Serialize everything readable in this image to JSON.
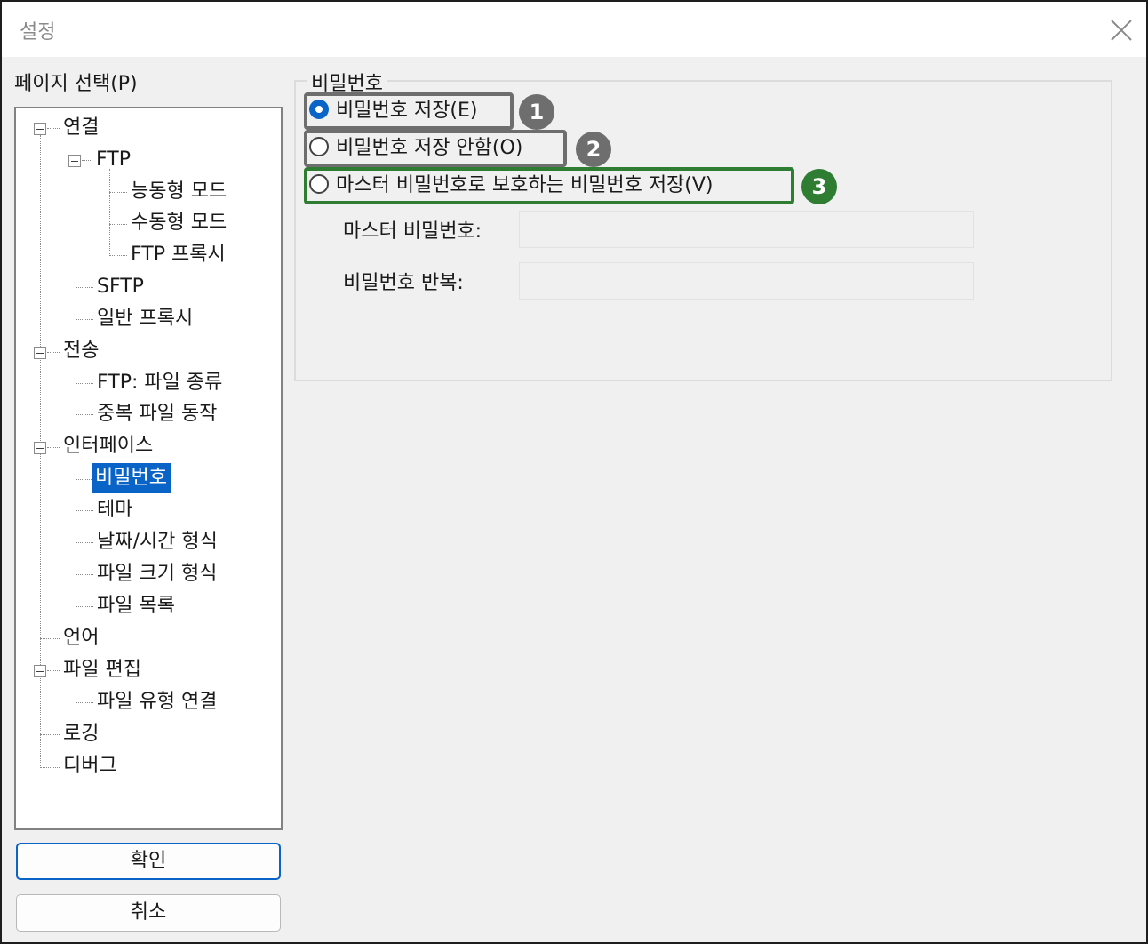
{
  "window": {
    "title": "설정"
  },
  "sidebar": {
    "label": "페이지 선택(P)",
    "tree": [
      {
        "label": "연결"
      },
      {
        "label": "FTP"
      },
      {
        "label": "능동형 모드"
      },
      {
        "label": "수동형 모드"
      },
      {
        "label": "FTP 프록시"
      },
      {
        "label": "SFTP"
      },
      {
        "label": "일반 프록시"
      },
      {
        "label": "전송"
      },
      {
        "label": "FTP: 파일 종류"
      },
      {
        "label": "중복 파일 동작"
      },
      {
        "label": "인터페이스"
      },
      {
        "label": "비밀번호",
        "selected": true
      },
      {
        "label": "테마"
      },
      {
        "label": "날짜/시간 형식"
      },
      {
        "label": "파일 크기 형식"
      },
      {
        "label": "파일 목록"
      },
      {
        "label": "언어"
      },
      {
        "label": "파일 편집"
      },
      {
        "label": "파일 유형 연결"
      },
      {
        "label": "로깅"
      },
      {
        "label": "디버그"
      }
    ]
  },
  "buttons": {
    "ok": "확인",
    "cancel": "취소"
  },
  "main": {
    "group_title": "비밀번호",
    "options": [
      {
        "label": "비밀번호 저장(E)",
        "checked": true,
        "badge": "1"
      },
      {
        "label": "비밀번호 저장 안함(O)",
        "checked": false,
        "badge": "2"
      },
      {
        "label": "마스터 비밀번호로 보호하는 비밀번호 저장(V)",
        "checked": false,
        "badge": "3"
      }
    ],
    "master_password_label": "마스터 비밀번호:",
    "master_password_value": "",
    "repeat_password_label": "비밀번호 반복:",
    "repeat_password_value": ""
  },
  "colors": {
    "selection": "#0a64c8",
    "highlight_gray": "#6e6e6e",
    "highlight_green": "#2e7d32"
  }
}
